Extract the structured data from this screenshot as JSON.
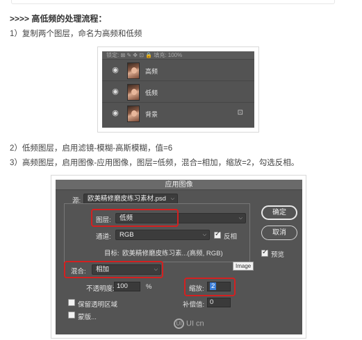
{
  "article": {
    "heading": ">>>> 高低频的处理流程：",
    "step1": "1）复制两个图层，命名为高频和低频",
    "step2": "2）低频图层，启用滤镜-模糊-高斯模糊，值=6",
    "step3": "3）高频图层，启用图像-应用图像，图层=低频，混合=相加，缩放=2，勾选反相。"
  },
  "layers_panel": {
    "lock_label": "锁定: ⊠ ✎ ✥ ⊡ 🔒 填充: 100%",
    "layers": [
      {
        "name": "高频",
        "visible": true,
        "locked": false
      },
      {
        "name": "低频",
        "visible": true,
        "locked": false
      },
      {
        "name": "背景",
        "visible": true,
        "locked": true
      }
    ]
  },
  "apply_image_dialog": {
    "title": "应用图像",
    "source_label": "源:",
    "source_value": "欧美精修磨皮练习素材.psd",
    "layer_label": "图层:",
    "layer_value": "低频",
    "channel_label": "通道:",
    "channel_value": "RGB",
    "invert_label": "反相",
    "invert_checked": true,
    "target_label": "目标:",
    "target_value": "欧美精修磨皮练习素...(高频, RGB)",
    "blend_label": "混合:",
    "blend_value": "相加",
    "opacity_label": "不透明度:",
    "opacity_value": "100",
    "opacity_unit": "%",
    "scale_label": "缩放:",
    "scale_value": "2",
    "offset_label": "补偿值:",
    "offset_value": "0",
    "preserve_transparency_label": "保留透明区域",
    "preserve_transparency_checked": false,
    "mask_label": "蒙版...",
    "mask_checked": false,
    "ok_label": "确定",
    "cancel_label": "取消",
    "preview_label": "预览",
    "preview_checked": true,
    "tooltip": "Image",
    "watermark": "UI cn",
    "watermark_logo": "UI"
  },
  "colors": {
    "highlight_box": "#d42020",
    "panel_bg": "#535353"
  }
}
